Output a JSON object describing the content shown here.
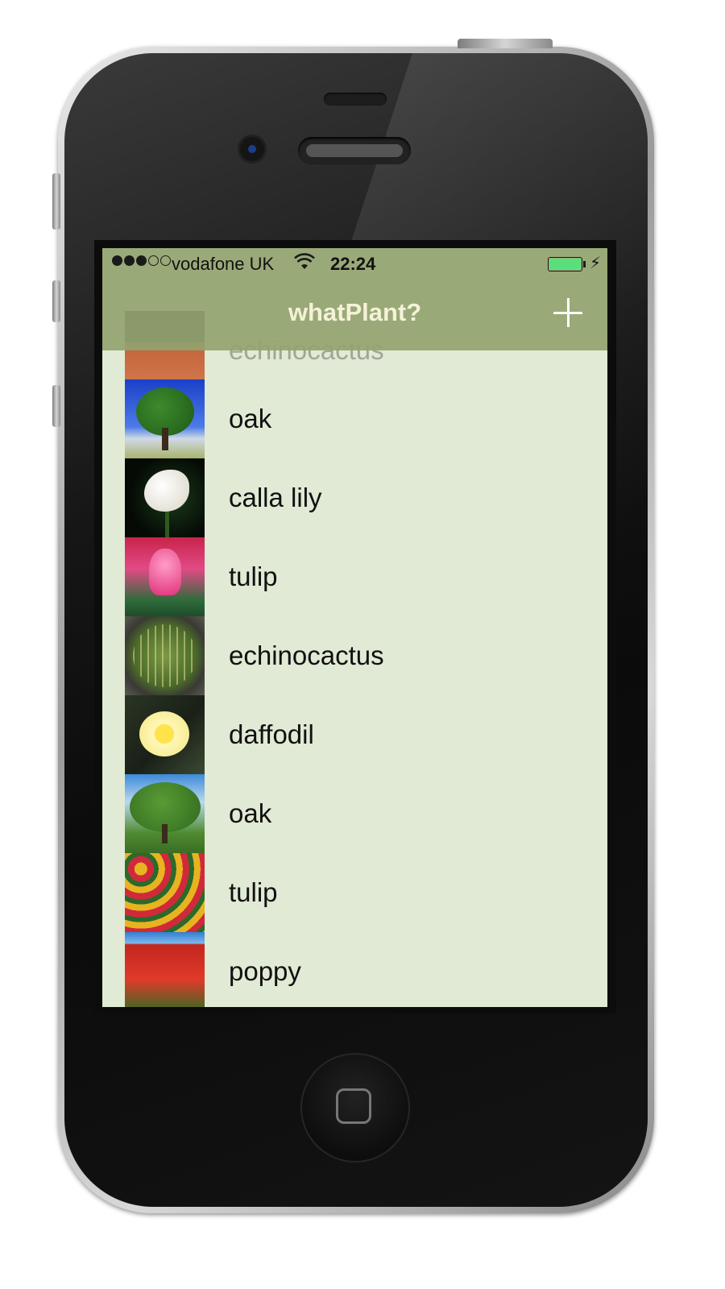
{
  "status_bar": {
    "signal_full": 3,
    "signal_empty": 2,
    "carrier": "vodafone UK",
    "time": "22:24",
    "battery_color": "#5ae07a"
  },
  "nav": {
    "title": "whatPlant?",
    "add_icon": "plus-icon"
  },
  "plants": [
    {
      "name": "echinocactus",
      "thumb": "cactus-pot"
    },
    {
      "name": "oak",
      "thumb": "oak-tree"
    },
    {
      "name": "calla lily",
      "thumb": "calla-lily"
    },
    {
      "name": "tulip",
      "thumb": "pink-tulips"
    },
    {
      "name": "echinocactus",
      "thumb": "barrel-cactus"
    },
    {
      "name": "daffodil",
      "thumb": "daffodil"
    },
    {
      "name": "oak",
      "thumb": "oak-field"
    },
    {
      "name": "tulip",
      "thumb": "red-yellow-tulips"
    },
    {
      "name": "poppy",
      "thumb": "poppy-field"
    }
  ],
  "colors": {
    "nav_bar": "#94a370",
    "list_background": "#e1ead4",
    "nav_title": "#f4f2d8"
  }
}
